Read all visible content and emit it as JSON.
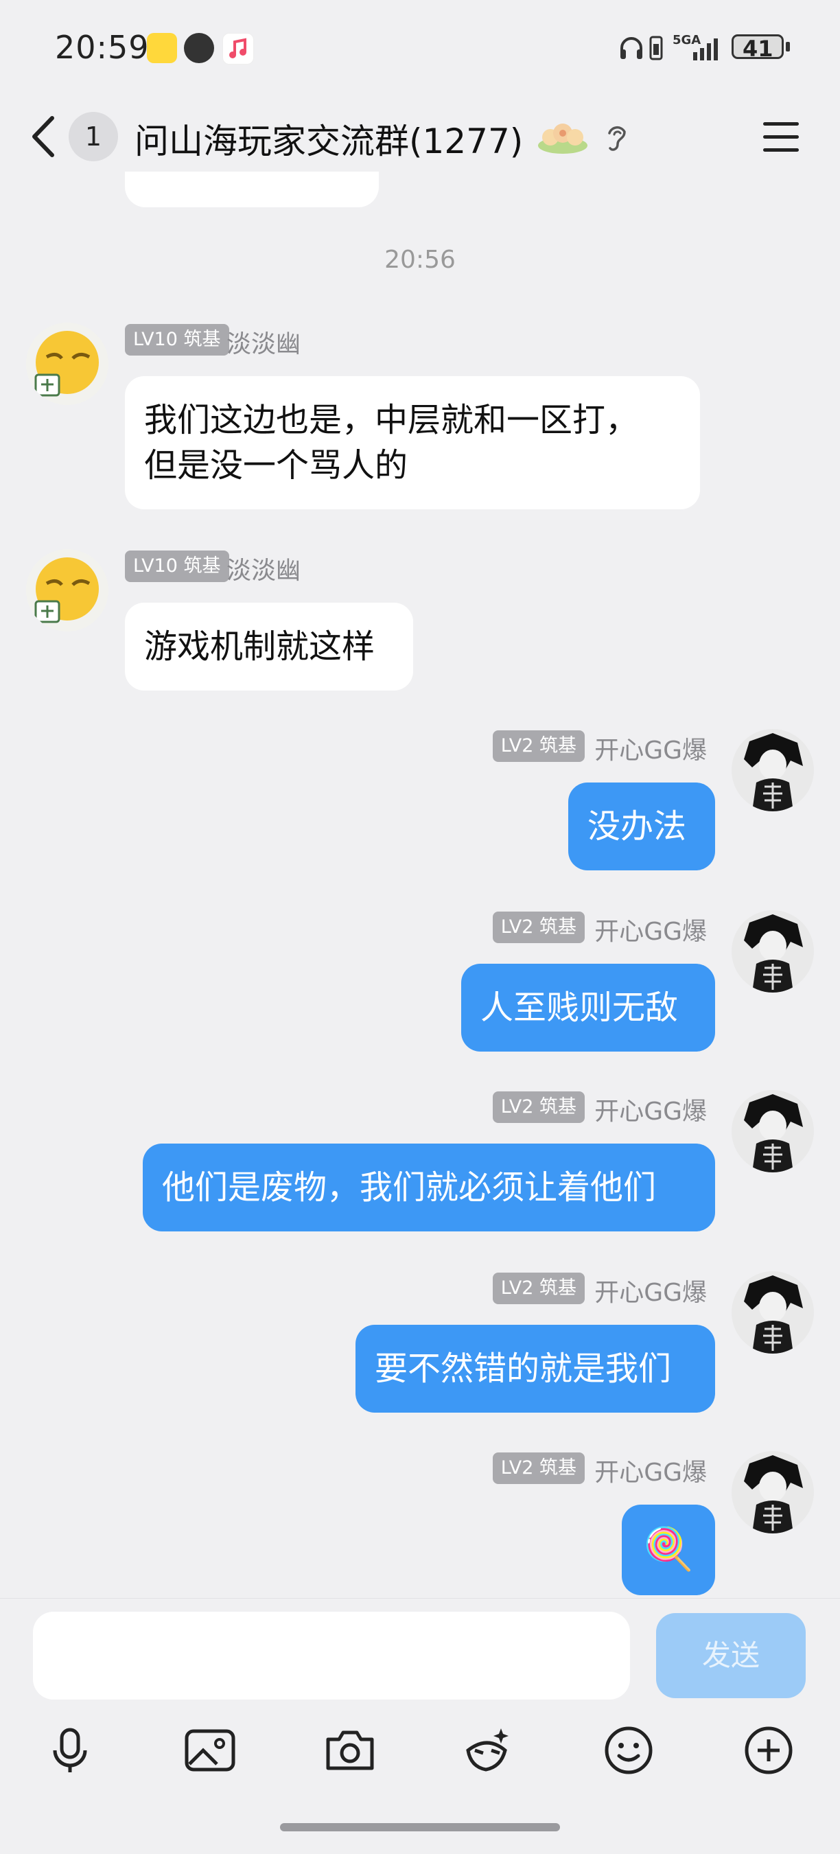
{
  "status_bar": {
    "time": "20:59",
    "network": "5GA",
    "battery": "41"
  },
  "header": {
    "unread_count": "1",
    "title": "问山海玩家交流群(1277)"
  },
  "chat": {
    "timestamp": "20:56",
    "messages": [
      {
        "side": "in",
        "level": "LV10 筑基",
        "sender": "淡淡幽",
        "lines": [
          "我们这边也是，中层就和一区打，",
          "但是没一个骂人的"
        ]
      },
      {
        "side": "in",
        "level": "LV10 筑基",
        "sender": "淡淡幽",
        "lines": [
          "游戏机制就这样"
        ]
      },
      {
        "side": "out",
        "level": "LV2 筑基",
        "sender": "开心GG爆",
        "lines": [
          "没办法"
        ]
      },
      {
        "side": "out",
        "level": "LV2 筑基",
        "sender": "开心GG爆",
        "lines": [
          "人至贱则无敌"
        ]
      },
      {
        "side": "out",
        "level": "LV2 筑基",
        "sender": "开心GG爆",
        "lines": [
          "他们是废物，我们就必须让着他们"
        ]
      },
      {
        "side": "out",
        "level": "LV2 筑基",
        "sender": "开心GG爆",
        "lines": [
          "要不然错的就是我们"
        ]
      },
      {
        "side": "out",
        "level": "LV2 筑基",
        "sender": "开心GG爆",
        "lines": [
          "🍭"
        ],
        "emoji": true
      }
    ]
  },
  "composer": {
    "input_value": "",
    "send_label": "发送",
    "tools": [
      "microphone-icon",
      "image-icon",
      "camera-icon",
      "magic-face-icon",
      "emoji-icon",
      "plus-icon"
    ]
  }
}
